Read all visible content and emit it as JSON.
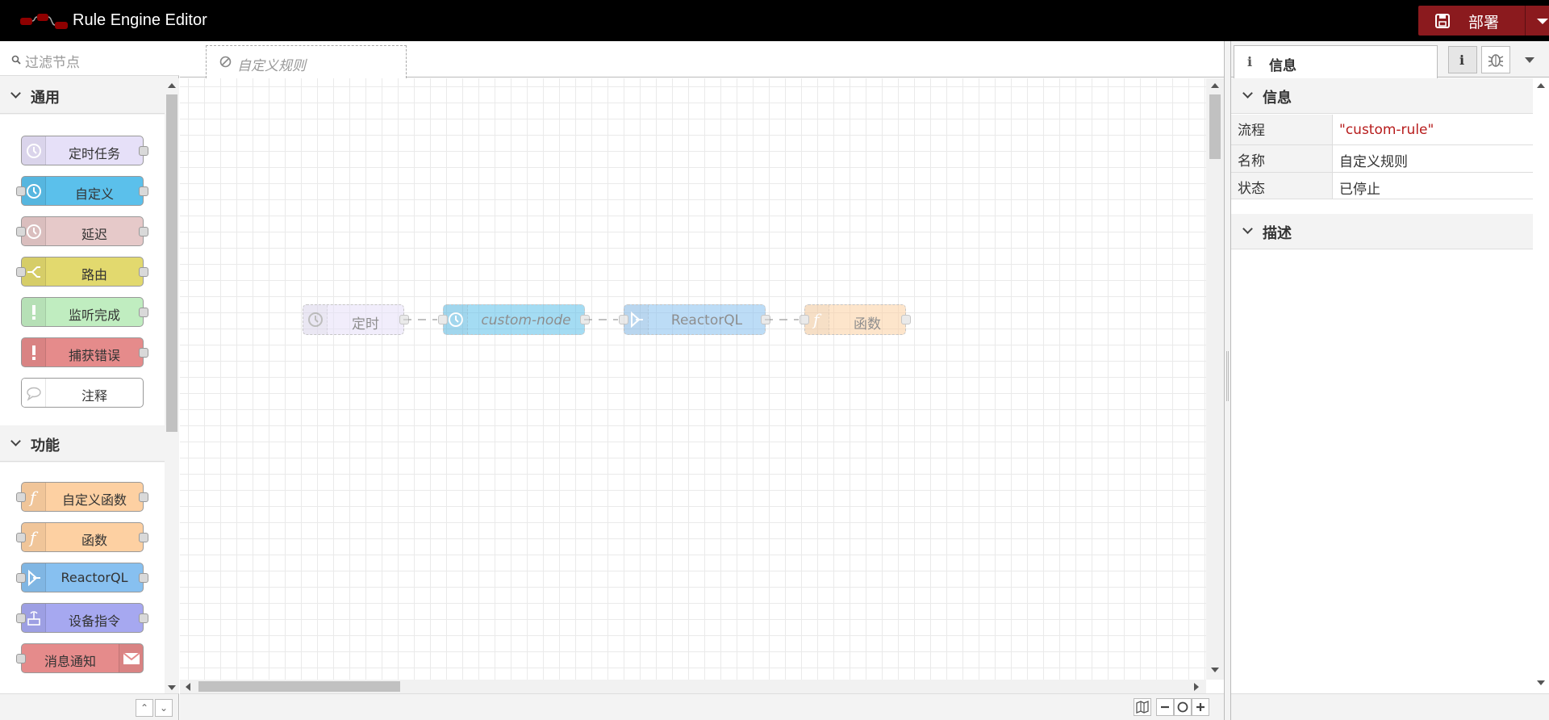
{
  "header": {
    "title": "Rule Engine Editor",
    "deploy_label": "部署",
    "logo_icon": "node-red-logo-icon",
    "colors": {
      "bar": "#000000",
      "deploy": "#8b1a1e"
    }
  },
  "palette": {
    "filter_placeholder": "过滤节点",
    "categories": [
      {
        "name": "通用",
        "nodes": [
          {
            "label": "定时任务",
            "color": "#e6e0f8",
            "icon": "timer-icon"
          },
          {
            "label": "自定义",
            "color": "#5bc0eb",
            "icon": "timer-icon"
          },
          {
            "label": "延迟",
            "color": "#e6c9c9",
            "icon": "timer-icon"
          },
          {
            "label": "路由",
            "color": "#e2d96e",
            "icon": "switch-icon"
          },
          {
            "label": "监听完成",
            "color": "#c0edc0",
            "icon": "exclamation-icon"
          },
          {
            "label": "捕获错误",
            "color": "#e58b8b",
            "icon": "exclamation-icon"
          },
          {
            "label": "注释",
            "color": "#ffffff",
            "icon": "comment-icon"
          }
        ]
      },
      {
        "name": "功能",
        "nodes": [
          {
            "label": "自定义函数",
            "color": "#fdd0a2",
            "icon": "function-icon"
          },
          {
            "label": "函数",
            "color": "#fdd0a2",
            "icon": "function-icon"
          },
          {
            "label": "ReactorQL",
            "color": "#87c0f0",
            "icon": "reactorql-icon"
          },
          {
            "label": "设备指令",
            "color": "#a6a8f0",
            "icon": "device-icon"
          },
          {
            "label": "消息通知",
            "color": "#e58b8b",
            "icon": "envelope-icon"
          }
        ]
      }
    ]
  },
  "workspace": {
    "tab_label": "自定义规则",
    "flow_nodes": [
      {
        "label": "定时",
        "color": "#e6e0f8",
        "icon": "timer-icon",
        "italic": false
      },
      {
        "label": "custom-node",
        "color": "#5bc0eb",
        "icon": "timer-icon",
        "italic": true
      },
      {
        "label": "ReactorQL",
        "color": "#87c0f0",
        "icon": "reactorql-icon",
        "italic": false
      },
      {
        "label": "函数",
        "color": "#fdd0a2",
        "icon": "function-icon",
        "italic": false
      }
    ]
  },
  "sidebar": {
    "tab_label": "信息",
    "sections": {
      "info": "信息",
      "description": "描述"
    },
    "properties": [
      {
        "key": "流程",
        "value": "\"custom-rule\""
      },
      {
        "key": "名称",
        "value": "自定义规则"
      },
      {
        "key": "状态",
        "value": "已停止"
      }
    ]
  }
}
